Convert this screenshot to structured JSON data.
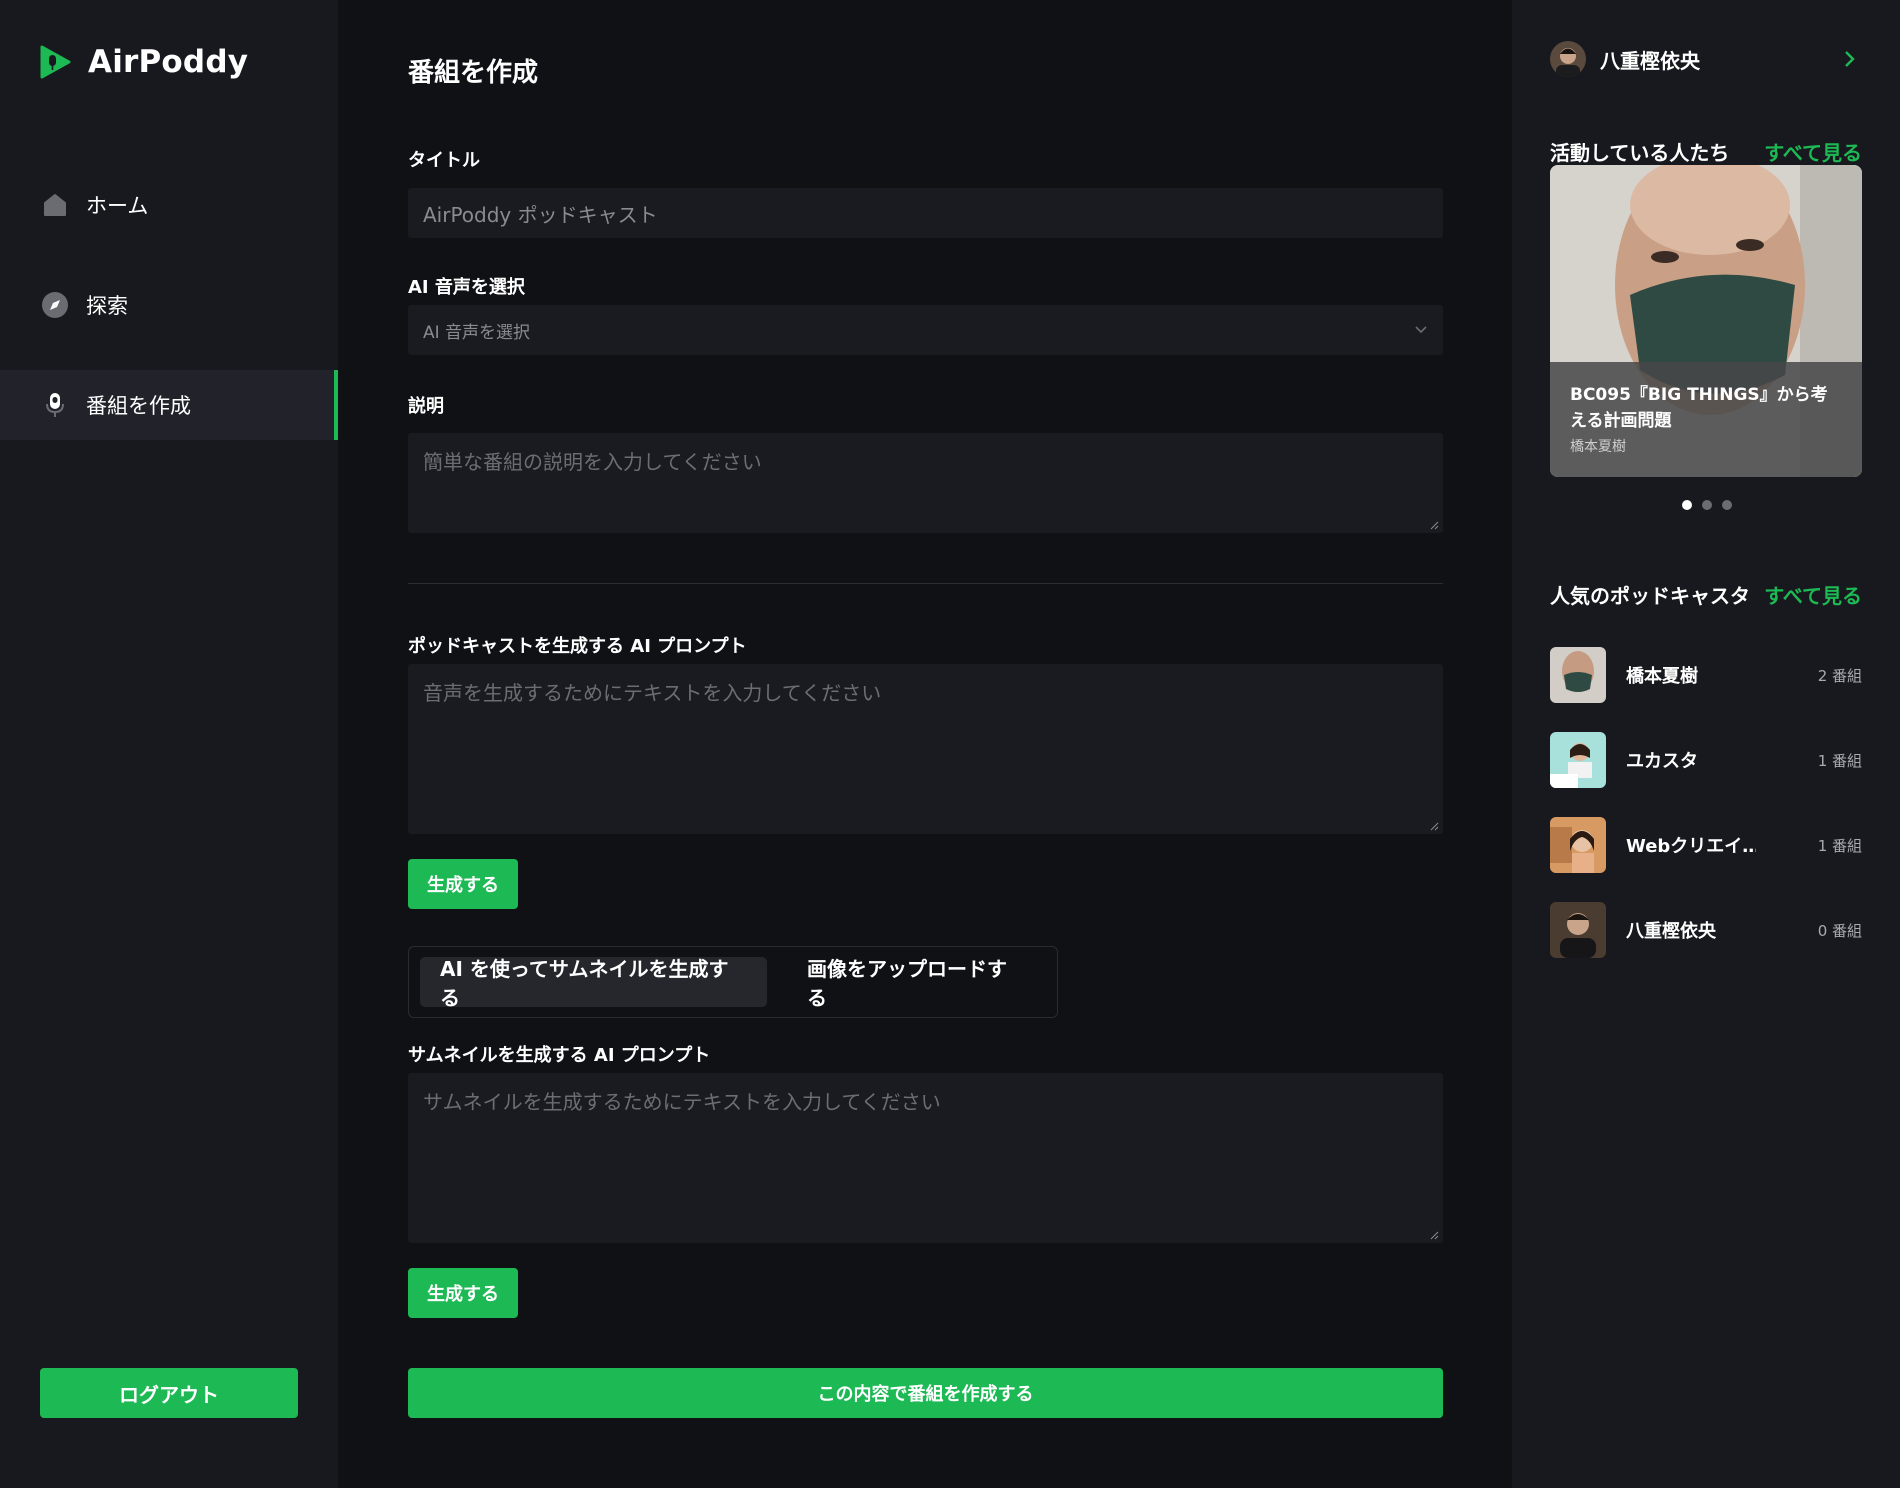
{
  "brand": {
    "name": "AirPoddy",
    "accent": "#1db954"
  },
  "sidebar": {
    "items": [
      {
        "label": "ホーム",
        "icon": "home-icon"
      },
      {
        "label": "探索",
        "icon": "compass-icon"
      },
      {
        "label": "番組を作成",
        "icon": "microphone-icon",
        "active": true
      }
    ],
    "logout_label": "ログアウト"
  },
  "main": {
    "title": "番組を作成",
    "title_label": "タイトル",
    "title_placeholder": "AirPoddy ポッドキャスト",
    "voice_label": "AI 音声を選択",
    "voice_selected": "AI 音声を選択",
    "description_label": "説明",
    "description_placeholder": "簡単な番組の説明を入力してください",
    "podcast_prompt_label": "ポッドキャストを生成する AI プロンプト",
    "podcast_prompt_placeholder": "音声を生成するためにテキストを入力してください",
    "generate_label": "生成する",
    "tabs": [
      {
        "label": "AI を使ってサムネイルを生成する",
        "active": true
      },
      {
        "label": "画像をアップロードする",
        "active": false
      }
    ],
    "thumbnail_prompt_label": "サムネイルを生成する AI プロンプト",
    "thumbnail_prompt_placeholder": "サムネイルを生成するためにテキストを入力してください",
    "generate_label_2": "生成する",
    "submit_label": "この内容で番組を作成する"
  },
  "right_panel": {
    "user": {
      "name": "八重樫依央"
    },
    "active_section": {
      "title": "活動している人たち",
      "see_all": "すべて見る"
    },
    "featured": {
      "title": "BC095『BIG THINGS』から考える計画問題",
      "author": "橋本夏樹",
      "slides": 3,
      "current_slide": 1
    },
    "popular_section": {
      "title": "人気のポッドキャスタ",
      "see_all": "すべて見る"
    },
    "podcasters": [
      {
        "name": "橋本夏樹",
        "count": "2 番組"
      },
      {
        "name": "ユカスタ",
        "count": "1 番組"
      },
      {
        "name": "Webクリエイ…",
        "count": "1 番組"
      },
      {
        "name": "八重樫依央",
        "count": "0 番組"
      }
    ]
  }
}
